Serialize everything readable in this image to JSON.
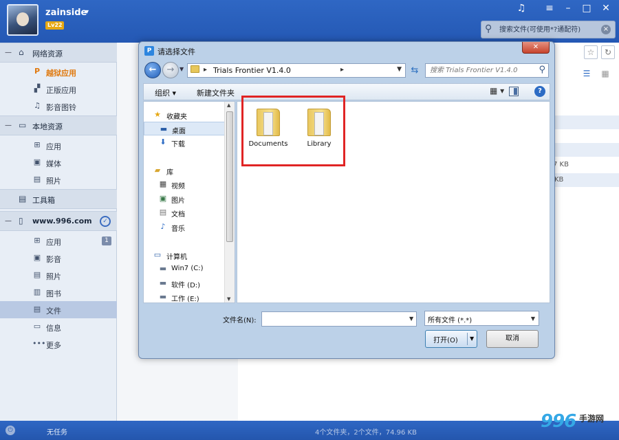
{
  "app": {
    "username": "zainside",
    "level": "Lv22",
    "search_placeholder": "搜索文件(可使用*?通配符)"
  },
  "sidebar": {
    "sections": [
      {
        "label": "网络资源",
        "icon": "globe-icon"
      },
      {
        "label": "本地资源",
        "icon": "monitor-icon"
      },
      {
        "label": "工具箱",
        "icon": "toolbox-icon"
      },
      {
        "label": "www.996.com",
        "icon": "phone-icon"
      }
    ],
    "network_items": [
      {
        "label": "越狱应用",
        "icon": "p-logo-icon"
      },
      {
        "label": "正版应用",
        "icon": "apps-icon"
      },
      {
        "label": "影音图铃",
        "icon": "music-note-icon"
      }
    ],
    "local_items": [
      {
        "label": "应用",
        "icon": "grid-icon"
      },
      {
        "label": "媒体",
        "icon": "media-icon"
      },
      {
        "label": "照片",
        "icon": "photo-icon"
      }
    ],
    "device_items": [
      {
        "label": "应用",
        "icon": "grid-icon",
        "badge": "1"
      },
      {
        "label": "影音",
        "icon": "media-icon"
      },
      {
        "label": "照片",
        "icon": "photo-icon"
      },
      {
        "label": "图书",
        "icon": "book-icon"
      },
      {
        "label": "文件",
        "icon": "file-icon"
      },
      {
        "label": "信息",
        "icon": "message-icon"
      },
      {
        "label": "更多",
        "icon": "more-icon"
      }
    ]
  },
  "background": {
    "size_1": "7 KB",
    "size_2": "KB"
  },
  "statusbar": {
    "task_label": "无任务",
    "summary": "4个文件夹，2个文件，74.96 KB"
  },
  "watermark": {
    "number": "996",
    "text": "手游网"
  },
  "dialog": {
    "title": "请选择文件",
    "icon_letter": "P",
    "breadcrumb": "Trials Frontier V1.4.0",
    "search_placeholder": "搜索 Trials Frontier V1.4.0",
    "toolbar": {
      "organize": "组织 ▾",
      "new_folder": "新建文件夹"
    },
    "tree": [
      {
        "label": "收藏夹",
        "icon": "star-icon"
      },
      {
        "label": "桌面",
        "icon": "desktop-icon"
      },
      {
        "label": "下载",
        "icon": "download-icon"
      },
      {
        "label": "库",
        "icon": "library-icon"
      },
      {
        "label": "视频",
        "icon": "video-icon"
      },
      {
        "label": "图片",
        "icon": "picture-icon"
      },
      {
        "label": "文档",
        "icon": "document-icon"
      },
      {
        "label": "音乐",
        "icon": "music-icon"
      },
      {
        "label": "计算机",
        "icon": "computer-icon"
      },
      {
        "label": "Win7 (C:)",
        "icon": "drive-c-icon"
      },
      {
        "label": "软件 (D:)",
        "icon": "drive-d-icon"
      },
      {
        "label": "工作 (E:)",
        "icon": "drive-e-icon"
      }
    ],
    "files": [
      {
        "name": "Documents"
      },
      {
        "name": "Library"
      }
    ],
    "filename_label": "文件名(N):",
    "filename_value": "",
    "filetype_value": "所有文件 (*.*)",
    "open_label": "打开(O)",
    "cancel_label": "取消"
  },
  "colors": {
    "topbar": "#2f67c4",
    "highlight_box": "#e02424",
    "active_nav": "#e07a10"
  }
}
